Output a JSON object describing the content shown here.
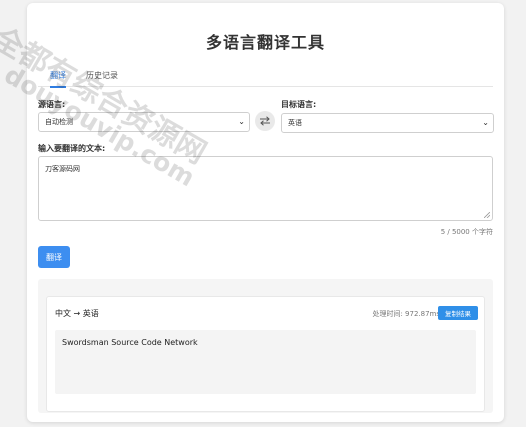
{
  "app": {
    "title": "多语言翻译工具"
  },
  "tabs": [
    {
      "label": "翻译",
      "active": true
    },
    {
      "label": "历史记录",
      "active": false
    }
  ],
  "source": {
    "label": "源语言:",
    "selected": "自动检测"
  },
  "target": {
    "label": "目标语言:",
    "selected": "英语"
  },
  "input": {
    "label": "输入要翻译的文本:",
    "value": "刀客源码网",
    "counter": "5 / 5000 个字符"
  },
  "actions": {
    "translate_label": "翻译",
    "copy_label": "复制结果"
  },
  "result": {
    "lang_pair": "中文 → 英语",
    "time_label": "处理时间: 972.87ms",
    "output": "Swordsman Source Code Network"
  },
  "watermark": {
    "line1": "全都有综合资源网",
    "line2": "douyouvip.com"
  },
  "colors": {
    "accent": "#2f7de1",
    "button": "#3d8ef0"
  }
}
